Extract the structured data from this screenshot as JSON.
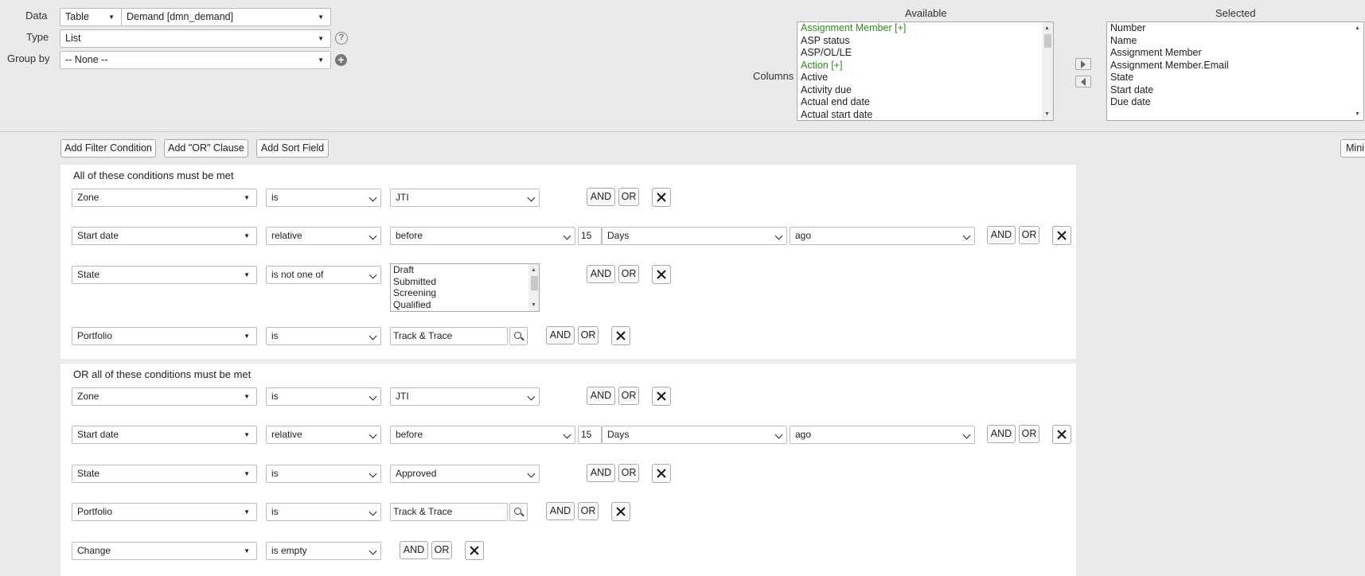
{
  "top": {
    "data_label": "Data",
    "type_label": "Type",
    "groupby_label": "Group by",
    "data_source": "Table",
    "data_table": "Demand [dmn_demand]",
    "type_value": "List",
    "groupby_value": "-- None --",
    "help_glyph": "?",
    "add_glyph": "+"
  },
  "columns": {
    "label": "Columns",
    "available_label": "Available",
    "selected_label": "Selected",
    "available": [
      {
        "text": "Assignment Member [+]",
        "expandable": true
      },
      {
        "text": "ASP status",
        "expandable": false
      },
      {
        "text": "ASP/OL/LE",
        "expandable": false
      },
      {
        "text": "Action [+]",
        "expandable": true
      },
      {
        "text": "Active",
        "expandable": false
      },
      {
        "text": "Activity due",
        "expandable": false
      },
      {
        "text": "Actual end date",
        "expandable": false
      },
      {
        "text": "Actual start date",
        "expandable": false
      }
    ],
    "selected": [
      "Number",
      "Name",
      "Assignment Member",
      "Assignment Member.Email",
      "State",
      "Start date",
      "Due date"
    ]
  },
  "toolbar": {
    "add_filter": "Add Filter Condition",
    "add_or": "Add \"OR\" Clause",
    "add_sort": "Add Sort Field",
    "mini": "Mini"
  },
  "groups": [
    {
      "heading": "All of these conditions must be met",
      "rows": [
        {
          "field": "Zone",
          "op": "is",
          "value": "JTI"
        },
        {
          "field": "Start date",
          "op": "relative",
          "value": "before",
          "num": "15",
          "unit": "Days",
          "ago": "ago"
        },
        {
          "field": "State",
          "op": "is not one of",
          "options": [
            "Draft",
            "Submitted",
            "Screening",
            "Qualified"
          ]
        },
        {
          "field": "Portfolio",
          "op": "is",
          "value": "Track & Trace"
        }
      ]
    },
    {
      "heading": "OR all of these conditions must be met",
      "rows": [
        {
          "field": "Zone",
          "op": "is",
          "value": "JTI"
        },
        {
          "field": "Start date",
          "op": "relative",
          "value": "before",
          "num": "15",
          "unit": "Days",
          "ago": "ago"
        },
        {
          "field": "State",
          "op": "is",
          "value": "Approved"
        },
        {
          "field": "Portfolio",
          "op": "is",
          "value": "Track & Trace"
        },
        {
          "field": "Change",
          "op": "is empty"
        }
      ]
    }
  ],
  "ui": {
    "and": "AND",
    "or": "OR"
  },
  "colors": {
    "expandable_text": "#2e8b1e",
    "background": "#e9eaec"
  }
}
